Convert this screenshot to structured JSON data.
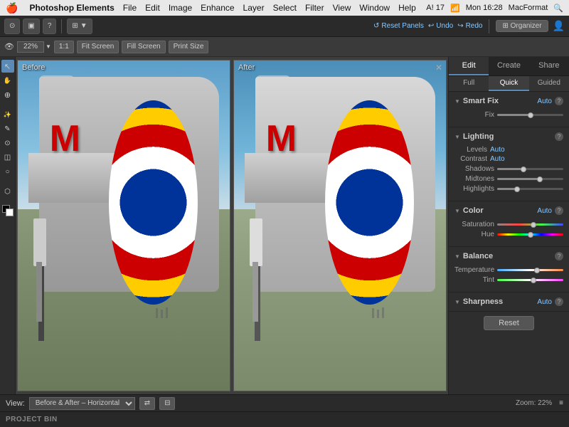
{
  "menubar": {
    "apple": "🍎",
    "appname": "Photoshop Elements",
    "menus": [
      "File",
      "Edit",
      "Image",
      "Enhance",
      "Layer",
      "Select",
      "Filter",
      "View",
      "Window",
      "Help"
    ],
    "rightinfo": "A! 17",
    "time": "Mon 16:28",
    "macformat": "MacFormat"
  },
  "toolbar": {
    "reset_panels": "Reset Panels",
    "undo": "Undo",
    "redo": "Redo",
    "organizer": "Organizer"
  },
  "viewcontrols": {
    "zoom": "22%",
    "zoom_label": "22%",
    "ratio": "1:1",
    "fit_screen": "Fit Screen",
    "fill_screen": "Fill Screen",
    "print_size": "Print Size"
  },
  "panels": {
    "before_label": "Before",
    "after_label": "After"
  },
  "right_panel": {
    "edit_tabs": [
      "Edit",
      "Create",
      "Share"
    ],
    "active_edit": "Edit",
    "mode_tabs": [
      "Full",
      "Quick",
      "Guided"
    ],
    "active_mode": "Quick",
    "smart_fix": {
      "title": "Smart Fix",
      "auto_label": "Auto",
      "fix_label": "Fix",
      "fix_value": 50
    },
    "lighting": {
      "title": "Lighting",
      "levels_label": "Levels",
      "levels_value": "Auto",
      "contrast_label": "Contrast",
      "contrast_value": "Auto",
      "shadows_label": "Shadows",
      "shadows_value": 40,
      "midtones_label": "Midtones",
      "midtones_value": 65,
      "highlights_label": "Highlights",
      "highlights_value": 30
    },
    "color": {
      "title": "Color",
      "auto_label": "Auto",
      "saturation_label": "Saturation",
      "saturation_value": 55,
      "hue_label": "Hue",
      "hue_value": 50
    },
    "balance": {
      "title": "Balance",
      "temperature_label": "Temperature",
      "temperature_value": 60,
      "tint_label": "Tint",
      "tint_value": 55
    },
    "sharpness": {
      "title": "Sharpness",
      "auto_label": "Auto"
    },
    "reset_label": "Reset"
  },
  "bottom": {
    "view_label": "View:",
    "view_option": "Before & After – Horizontal",
    "zoom_label": "Zoom:",
    "zoom_value": "22%"
  },
  "project_bin": {
    "label": "PROJECT BIN"
  }
}
